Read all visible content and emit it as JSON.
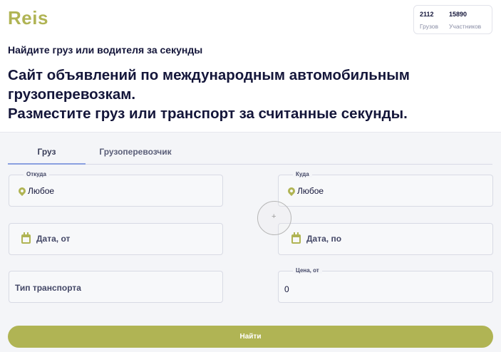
{
  "brand": {
    "logo": "Reis"
  },
  "stats": [
    {
      "value": "2112",
      "label": "Грузов"
    },
    {
      "value": "15890",
      "label": "Участников"
    }
  ],
  "subtitle": "Найдите груз или водителя за секунды",
  "hero": {
    "line1": "Сайт объявлений по международным автомобильным",
    "line2": "грузоперевозкам.",
    "line3": "Разместите груз или транспорт за считанные секунды."
  },
  "tabs": [
    {
      "label": "Груз",
      "active": true
    },
    {
      "label": "Грузоперевозчик",
      "active": false
    }
  ],
  "form": {
    "from": {
      "legend": "Откуда",
      "value": "Любое"
    },
    "to": {
      "legend": "Куда",
      "value": "Любое"
    },
    "date_from": {
      "placeholder": "Дата, от"
    },
    "date_to": {
      "placeholder": "Дата, по"
    },
    "transport_type": {
      "placeholder": "Тип транспорта"
    },
    "price_from": {
      "legend": "Цена, от",
      "value": "0"
    },
    "submit_label": "Найти"
  },
  "colors": {
    "accent": "#b0b454",
    "text": "#14163a",
    "tab_underline": "#8aa0e0"
  },
  "icons": {
    "location": "map-pin-icon",
    "date": "calendar-icon"
  }
}
